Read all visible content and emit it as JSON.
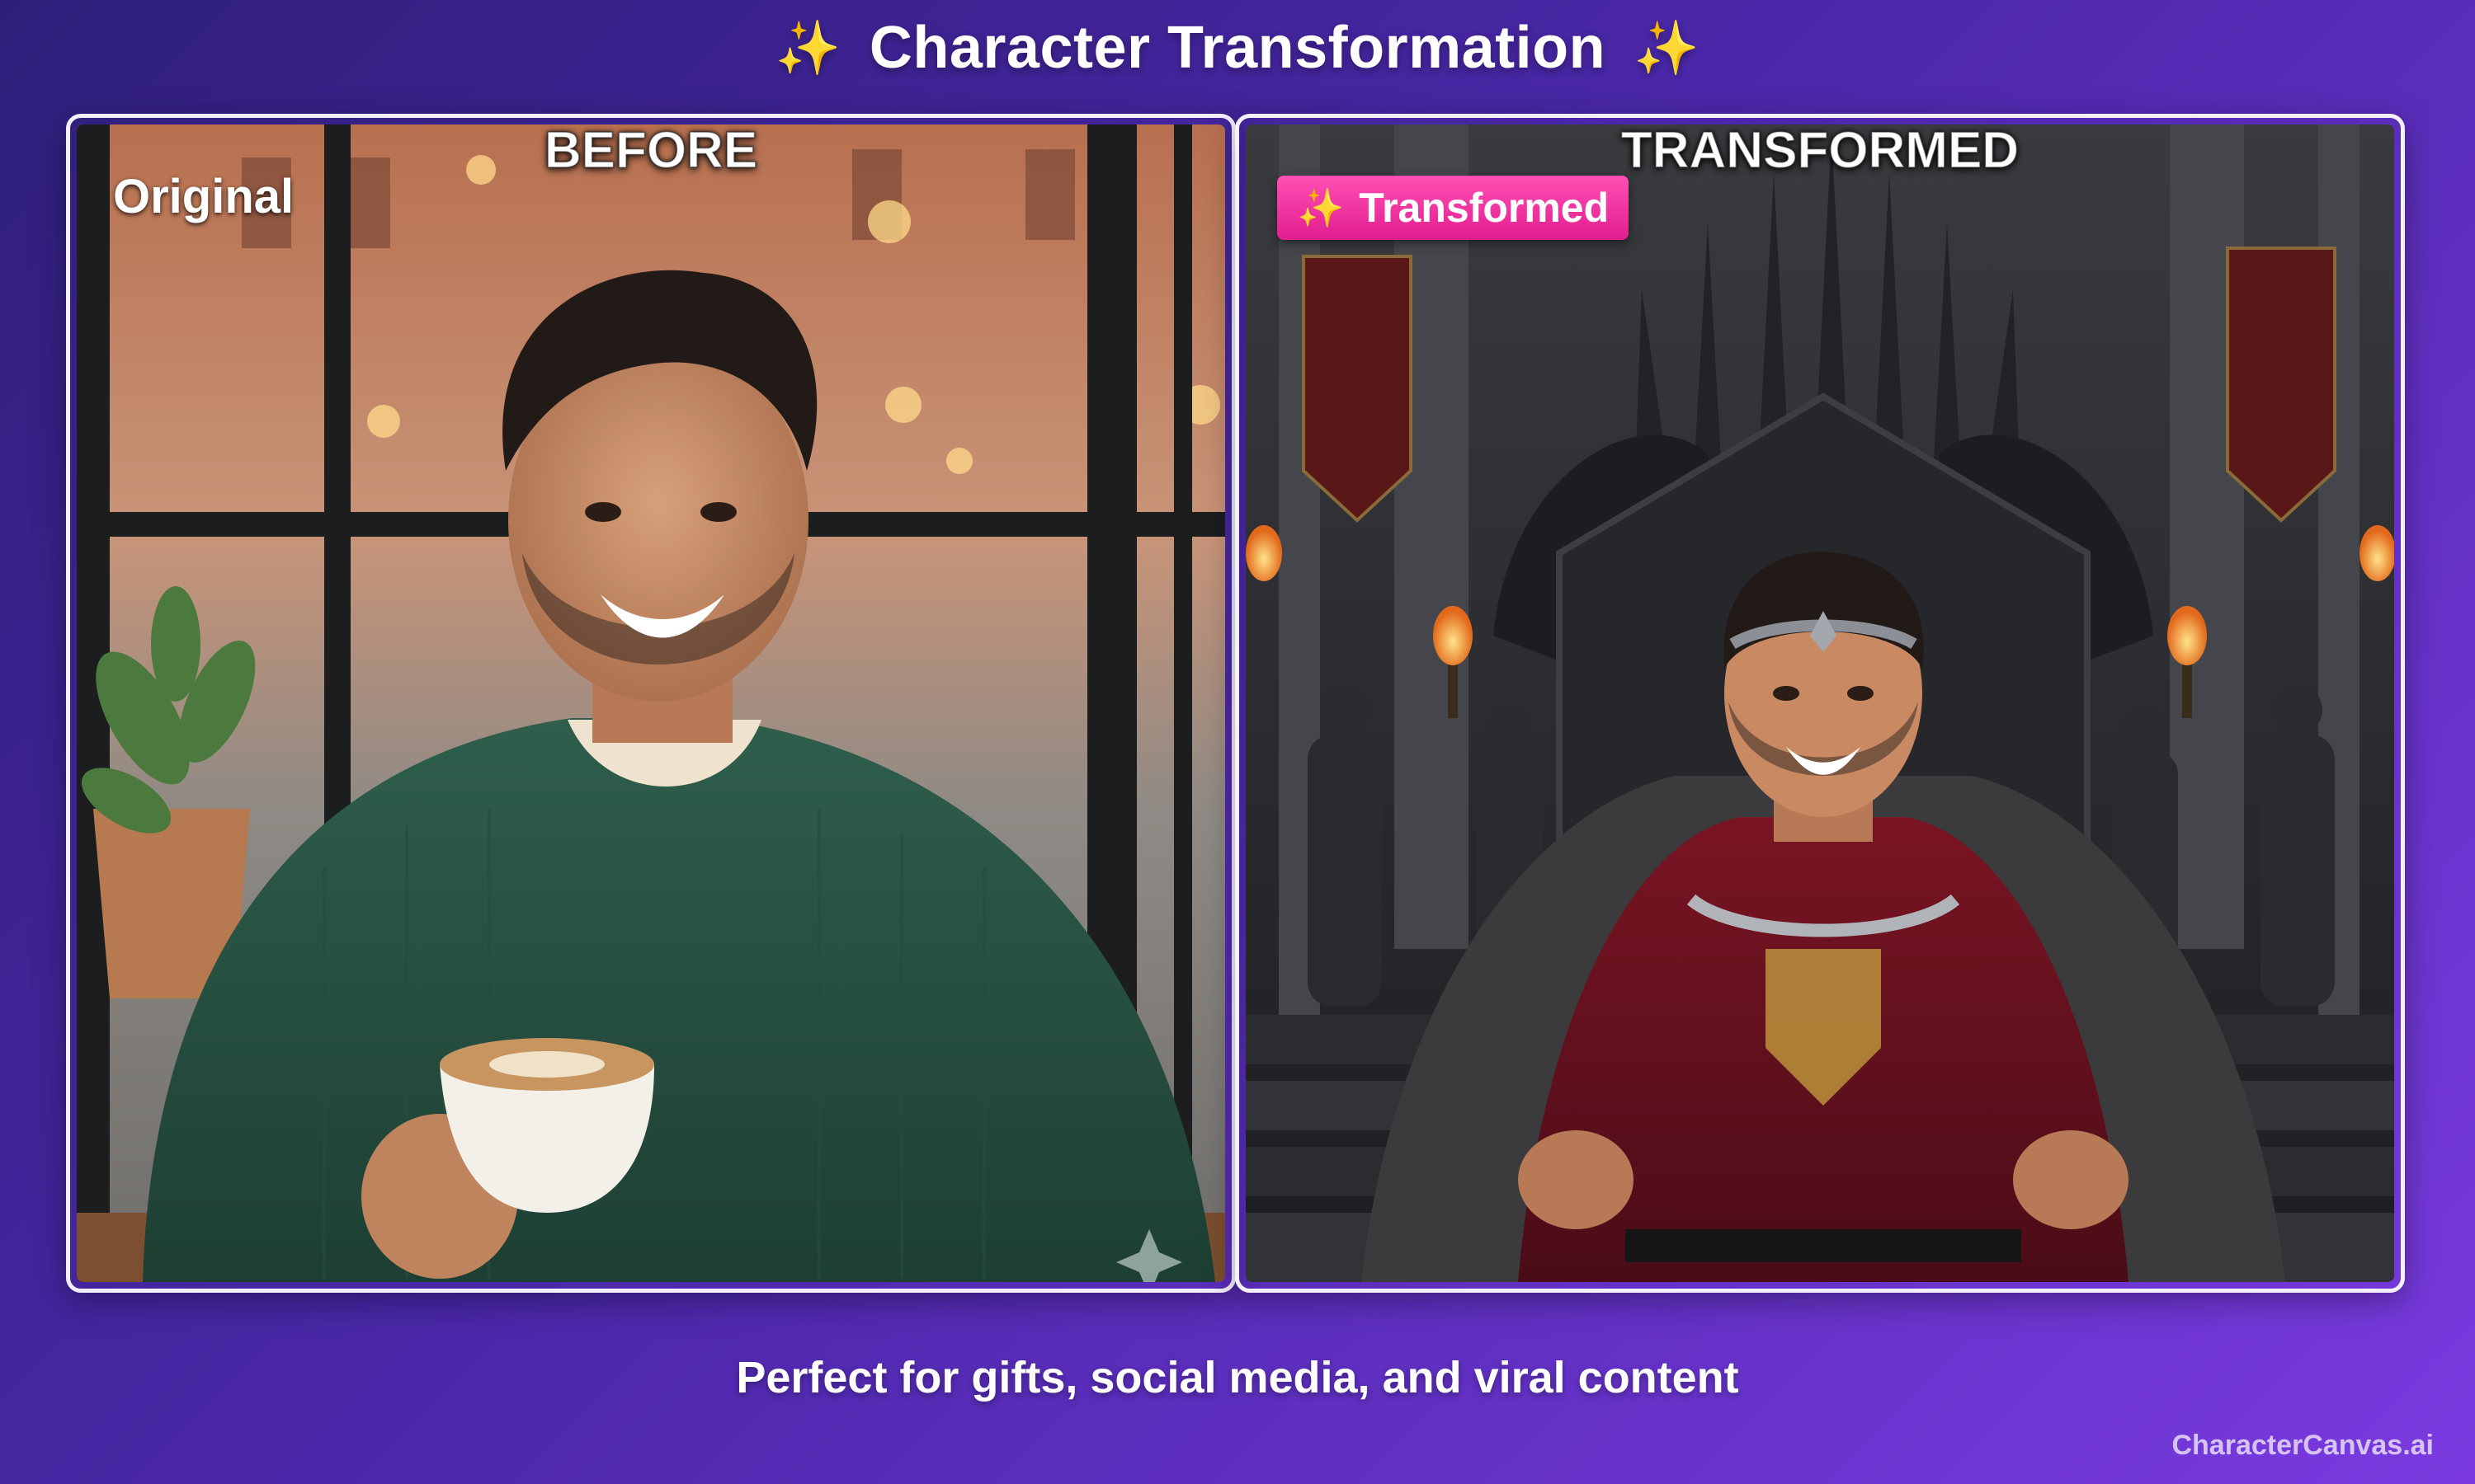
{
  "header": {
    "sparkle_left": "✨",
    "title": "Character Transformation",
    "sparkle_right": "✨"
  },
  "before": {
    "caption": "BEFORE",
    "badge": "Original"
  },
  "after": {
    "caption": "TRANSFORMED",
    "badge_icon": "✨",
    "badge": "Transformed"
  },
  "footer": {
    "tagline": "Perfect for gifts, social media, and viral content",
    "watermark": "CharacterCanvas.ai"
  },
  "colors": {
    "background_start": "#2f1f7a",
    "background_end": "#7a3ae0",
    "panel_border": "#f4f0ff",
    "badge_pink": "#e11d8f",
    "sparkle": "#ffd45a"
  }
}
